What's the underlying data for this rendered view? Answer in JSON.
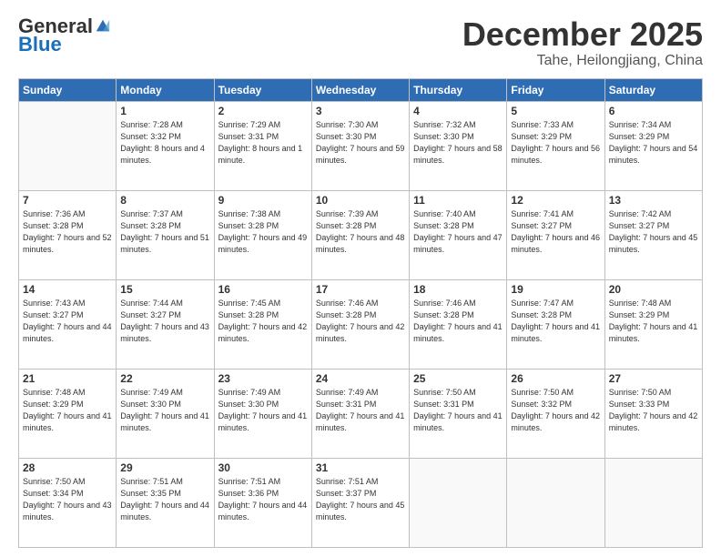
{
  "logo": {
    "general": "General",
    "blue": "Blue"
  },
  "header": {
    "month": "December 2025",
    "location": "Tahe, Heilongjiang, China"
  },
  "weekdays": [
    "Sunday",
    "Monday",
    "Tuesday",
    "Wednesday",
    "Thursday",
    "Friday",
    "Saturday"
  ],
  "weeks": [
    [
      {
        "day": "",
        "sunrise": "",
        "sunset": "",
        "daylight": ""
      },
      {
        "day": "1",
        "sunrise": "Sunrise: 7:28 AM",
        "sunset": "Sunset: 3:32 PM",
        "daylight": "Daylight: 8 hours and 4 minutes."
      },
      {
        "day": "2",
        "sunrise": "Sunrise: 7:29 AM",
        "sunset": "Sunset: 3:31 PM",
        "daylight": "Daylight: 8 hours and 1 minute."
      },
      {
        "day": "3",
        "sunrise": "Sunrise: 7:30 AM",
        "sunset": "Sunset: 3:30 PM",
        "daylight": "Daylight: 7 hours and 59 minutes."
      },
      {
        "day": "4",
        "sunrise": "Sunrise: 7:32 AM",
        "sunset": "Sunset: 3:30 PM",
        "daylight": "Daylight: 7 hours and 58 minutes."
      },
      {
        "day": "5",
        "sunrise": "Sunrise: 7:33 AM",
        "sunset": "Sunset: 3:29 PM",
        "daylight": "Daylight: 7 hours and 56 minutes."
      },
      {
        "day": "6",
        "sunrise": "Sunrise: 7:34 AM",
        "sunset": "Sunset: 3:29 PM",
        "daylight": "Daylight: 7 hours and 54 minutes."
      }
    ],
    [
      {
        "day": "7",
        "sunrise": "Sunrise: 7:36 AM",
        "sunset": "Sunset: 3:28 PM",
        "daylight": "Daylight: 7 hours and 52 minutes."
      },
      {
        "day": "8",
        "sunrise": "Sunrise: 7:37 AM",
        "sunset": "Sunset: 3:28 PM",
        "daylight": "Daylight: 7 hours and 51 minutes."
      },
      {
        "day": "9",
        "sunrise": "Sunrise: 7:38 AM",
        "sunset": "Sunset: 3:28 PM",
        "daylight": "Daylight: 7 hours and 49 minutes."
      },
      {
        "day": "10",
        "sunrise": "Sunrise: 7:39 AM",
        "sunset": "Sunset: 3:28 PM",
        "daylight": "Daylight: 7 hours and 48 minutes."
      },
      {
        "day": "11",
        "sunrise": "Sunrise: 7:40 AM",
        "sunset": "Sunset: 3:28 PM",
        "daylight": "Daylight: 7 hours and 47 minutes."
      },
      {
        "day": "12",
        "sunrise": "Sunrise: 7:41 AM",
        "sunset": "Sunset: 3:27 PM",
        "daylight": "Daylight: 7 hours and 46 minutes."
      },
      {
        "day": "13",
        "sunrise": "Sunrise: 7:42 AM",
        "sunset": "Sunset: 3:27 PM",
        "daylight": "Daylight: 7 hours and 45 minutes."
      }
    ],
    [
      {
        "day": "14",
        "sunrise": "Sunrise: 7:43 AM",
        "sunset": "Sunset: 3:27 PM",
        "daylight": "Daylight: 7 hours and 44 minutes."
      },
      {
        "day": "15",
        "sunrise": "Sunrise: 7:44 AM",
        "sunset": "Sunset: 3:27 PM",
        "daylight": "Daylight: 7 hours and 43 minutes."
      },
      {
        "day": "16",
        "sunrise": "Sunrise: 7:45 AM",
        "sunset": "Sunset: 3:28 PM",
        "daylight": "Daylight: 7 hours and 42 minutes."
      },
      {
        "day": "17",
        "sunrise": "Sunrise: 7:46 AM",
        "sunset": "Sunset: 3:28 PM",
        "daylight": "Daylight: 7 hours and 42 minutes."
      },
      {
        "day": "18",
        "sunrise": "Sunrise: 7:46 AM",
        "sunset": "Sunset: 3:28 PM",
        "daylight": "Daylight: 7 hours and 41 minutes."
      },
      {
        "day": "19",
        "sunrise": "Sunrise: 7:47 AM",
        "sunset": "Sunset: 3:28 PM",
        "daylight": "Daylight: 7 hours and 41 minutes."
      },
      {
        "day": "20",
        "sunrise": "Sunrise: 7:48 AM",
        "sunset": "Sunset: 3:29 PM",
        "daylight": "Daylight: 7 hours and 41 minutes."
      }
    ],
    [
      {
        "day": "21",
        "sunrise": "Sunrise: 7:48 AM",
        "sunset": "Sunset: 3:29 PM",
        "daylight": "Daylight: 7 hours and 41 minutes."
      },
      {
        "day": "22",
        "sunrise": "Sunrise: 7:49 AM",
        "sunset": "Sunset: 3:30 PM",
        "daylight": "Daylight: 7 hours and 41 minutes."
      },
      {
        "day": "23",
        "sunrise": "Sunrise: 7:49 AM",
        "sunset": "Sunset: 3:30 PM",
        "daylight": "Daylight: 7 hours and 41 minutes."
      },
      {
        "day": "24",
        "sunrise": "Sunrise: 7:49 AM",
        "sunset": "Sunset: 3:31 PM",
        "daylight": "Daylight: 7 hours and 41 minutes."
      },
      {
        "day": "25",
        "sunrise": "Sunrise: 7:50 AM",
        "sunset": "Sunset: 3:31 PM",
        "daylight": "Daylight: 7 hours and 41 minutes."
      },
      {
        "day": "26",
        "sunrise": "Sunrise: 7:50 AM",
        "sunset": "Sunset: 3:32 PM",
        "daylight": "Daylight: 7 hours and 42 minutes."
      },
      {
        "day": "27",
        "sunrise": "Sunrise: 7:50 AM",
        "sunset": "Sunset: 3:33 PM",
        "daylight": "Daylight: 7 hours and 42 minutes."
      }
    ],
    [
      {
        "day": "28",
        "sunrise": "Sunrise: 7:50 AM",
        "sunset": "Sunset: 3:34 PM",
        "daylight": "Daylight: 7 hours and 43 minutes."
      },
      {
        "day": "29",
        "sunrise": "Sunrise: 7:51 AM",
        "sunset": "Sunset: 3:35 PM",
        "daylight": "Daylight: 7 hours and 44 minutes."
      },
      {
        "day": "30",
        "sunrise": "Sunrise: 7:51 AM",
        "sunset": "Sunset: 3:36 PM",
        "daylight": "Daylight: 7 hours and 44 minutes."
      },
      {
        "day": "31",
        "sunrise": "Sunrise: 7:51 AM",
        "sunset": "Sunset: 3:37 PM",
        "daylight": "Daylight: 7 hours and 45 minutes."
      },
      {
        "day": "",
        "sunrise": "",
        "sunset": "",
        "daylight": ""
      },
      {
        "day": "",
        "sunrise": "",
        "sunset": "",
        "daylight": ""
      },
      {
        "day": "",
        "sunrise": "",
        "sunset": "",
        "daylight": ""
      }
    ]
  ]
}
